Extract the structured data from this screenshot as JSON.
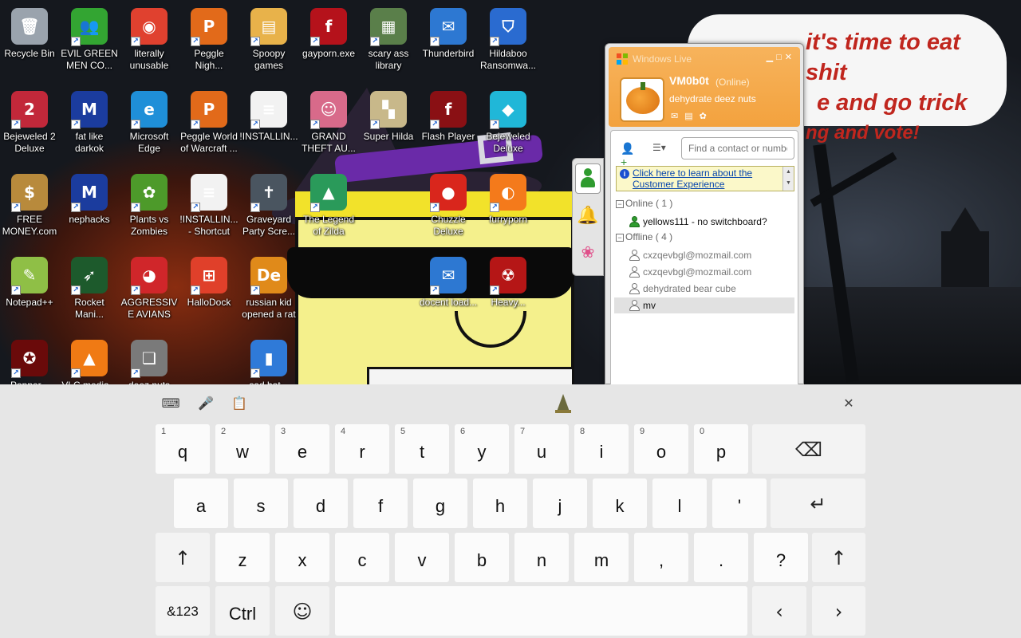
{
  "desktop": {
    "icons": [
      {
        "label": "Recycle Bin",
        "icon": "recycle-bin-icon",
        "color": "#9aa3ad",
        "glyph": "🗑"
      },
      {
        "label": "EVIL GREEN MEN CO...",
        "icon": "messenger-people-icon",
        "color": "#33a532",
        "glyph": "👥"
      },
      {
        "label": "literally unusable",
        "icon": "chrome-icon",
        "color": "#e0412f",
        "glyph": "◉"
      },
      {
        "label": "Peggle Nigh...",
        "icon": "peggle-icon",
        "color": "#e26a1a",
        "glyph": "P"
      },
      {
        "label": "Spoopy games",
        "icon": "folder-icon",
        "color": "#e8b24a",
        "glyph": "▤"
      },
      {
        "label": "gayporn.exe",
        "icon": "flash-icon",
        "color": "#b5121b",
        "glyph": "f"
      },
      {
        "label": "scary ass library",
        "icon": "library-icon",
        "color": "#5a7f4a",
        "glyph": "▦"
      },
      {
        "label": "Thunderbird",
        "icon": "thunderbird-icon",
        "color": "#2d78d2",
        "glyph": "✉"
      },
      {
        "label": "Hildaboo Ransomwa...",
        "icon": "yashma-shield-icon",
        "color": "#2a6bd0",
        "glyph": "⛉"
      },
      {
        "label": "Bejeweled 2 Deluxe",
        "icon": "bejeweled2-icon",
        "color": "#c2283a",
        "glyph": "2"
      },
      {
        "label": "fat like darkok",
        "icon": "mpi-icon",
        "color": "#1b3c9e",
        "glyph": "M"
      },
      {
        "label": "Microsoft Edge",
        "icon": "edge-icon",
        "color": "#1f8fd8",
        "glyph": "e"
      },
      {
        "label": "Peggle World of Warcraft ...",
        "icon": "peggle-wow-icon",
        "color": "#e26a1a",
        "glyph": "P"
      },
      {
        "label": "!INSTALLIN...",
        "icon": "document-icon",
        "color": "#f2f2f2",
        "glyph": "≡"
      },
      {
        "label": "GRAND THEFT AU...",
        "icon": "anime-girl-icon",
        "color": "#d86a8a",
        "glyph": "☺"
      },
      {
        "label": "Super Hilda",
        "icon": "hilda-pixel-icon",
        "color": "#c8b88a",
        "glyph": "▚"
      },
      {
        "label": "Flash Player",
        "icon": "flash-player-icon",
        "color": "#8a1014",
        "glyph": "f"
      },
      {
        "label": "Bejeweled Deluxe",
        "icon": "diamond-icon",
        "color": "#20b7d8",
        "glyph": "◆"
      },
      {
        "label": "FREE MONEY.com",
        "icon": "money-bag-icon",
        "color": "#b88a3c",
        "glyph": "$"
      },
      {
        "label": "nephacks",
        "icon": "mpi-blue-icon",
        "color": "#1b3c9e",
        "glyph": "M"
      },
      {
        "label": "Plants vs Zombies",
        "icon": "pvz-flower-icon",
        "color": "#4d9a2a",
        "glyph": "✿"
      },
      {
        "label": "!INSTALLIN... - Shortcut",
        "icon": "document-shortcut-icon",
        "color": "#f2f2f2",
        "glyph": "≡"
      },
      {
        "label": "Graveyard Party Scre...",
        "icon": "gravestone-icon",
        "color": "#4a5560",
        "glyph": "✝"
      },
      {
        "label": "The Legend of Zilda",
        "icon": "zelda-pixel-icon",
        "color": "#2a9a5a",
        "glyph": "▲"
      },
      {
        "label": "",
        "icon": "blank-icon",
        "color": "transparent",
        "glyph": ""
      },
      {
        "label": "Chuzzle Deluxe",
        "icon": "chuzzle-icon",
        "color": "#d9261c",
        "glyph": "●"
      },
      {
        "label": "furryporn",
        "icon": "firefox-icon",
        "color": "#f47a1b",
        "glyph": "◐"
      },
      {
        "label": "Notepad++",
        "icon": "notepadpp-icon",
        "color": "#8fbf46",
        "glyph": "✎"
      },
      {
        "label": "Rocket Mani...",
        "icon": "rocket-icon",
        "color": "#1d5a2c",
        "glyph": "➶"
      },
      {
        "label": "AGGRESSIVE AVIANS",
        "icon": "angry-bird-icon",
        "color": "#d0262a",
        "glyph": "◕"
      },
      {
        "label": "HalloDock",
        "icon": "windows-shield-icon",
        "color": "#e0402a",
        "glyph": "⊞"
      },
      {
        "label": "russian kid opened a rat",
        "icon": "de-logo-icon",
        "color": "#e08a1a",
        "glyph": "De"
      },
      {
        "label": "",
        "icon": "blank-icon",
        "color": "transparent",
        "glyph": ""
      },
      {
        "label": "",
        "icon": "blank-icon",
        "color": "transparent",
        "glyph": ""
      },
      {
        "label": "docent load...",
        "icon": "thunderbird-2-icon",
        "color": "#2d78d2",
        "glyph": "✉"
      },
      {
        "label": "Heavy...",
        "icon": "radiation-icon",
        "color": "#b51616",
        "glyph": "☢"
      },
      {
        "label": "Popper...",
        "icon": "pentagram-icon",
        "color": "#6a0a0a",
        "glyph": "✪"
      },
      {
        "label": "VLC media...",
        "icon": "vlc-icon",
        "color": "#f07a14",
        "glyph": "▲"
      },
      {
        "label": "deez nuts pr...",
        "icon": "windows-stack-icon",
        "color": "#7a7a7a",
        "glyph": "❏"
      },
      {
        "label": "",
        "icon": "blank-icon",
        "color": "transparent",
        "glyph": ""
      },
      {
        "label": "sad bat...",
        "icon": "usb-stick-icon",
        "color": "#2f7ad8",
        "glyph": "▮"
      }
    ]
  },
  "wallpaper": {
    "bubble_lines": [
      "it's time to eat shit",
      "e and go trick",
      "ng and vote!"
    ]
  },
  "messenger": {
    "title": "Windows Live",
    "user": {
      "name": "VM0b0t",
      "status": "(Online)",
      "message": "dehydrate deez nuts"
    },
    "search_placeholder": "Find a contact or number",
    "info_text": "Click here to learn about the Customer Experience",
    "groups": {
      "online": {
        "label": "Online ( 1 )",
        "contacts": [
          "yellows111 - no switchboard?"
        ]
      },
      "offline": {
        "label": "Offline ( 4 )",
        "contacts": [
          "cxzqevbgl@mozmail.com",
          "cxzqevbgl@mozmail.com",
          "dehydrated bear cube",
          "mv"
        ]
      }
    },
    "accent": "#f3a23e"
  },
  "keyboard": {
    "row1": [
      {
        "k": "q",
        "n": "1"
      },
      {
        "k": "w",
        "n": "2"
      },
      {
        "k": "e",
        "n": "3"
      },
      {
        "k": "r",
        "n": "4"
      },
      {
        "k": "t",
        "n": "5"
      },
      {
        "k": "y",
        "n": "6"
      },
      {
        "k": "u",
        "n": "7"
      },
      {
        "k": "i",
        "n": "8"
      },
      {
        "k": "o",
        "n": "9"
      },
      {
        "k": "p",
        "n": "0"
      }
    ],
    "row2": [
      "a",
      "s",
      "d",
      "f",
      "g",
      "h",
      "j",
      "k",
      "l",
      "'"
    ],
    "row3": [
      "z",
      "x",
      "c",
      "v",
      "b",
      "n",
      "m",
      ",",
      ".",
      "?"
    ],
    "backspace": "⌫",
    "enter": "↵",
    "shift": "↑",
    "symbols": "&123",
    "ctrl": "Ctrl",
    "emoji": "☺",
    "left": "‹",
    "right": "›",
    "close": "✕"
  }
}
